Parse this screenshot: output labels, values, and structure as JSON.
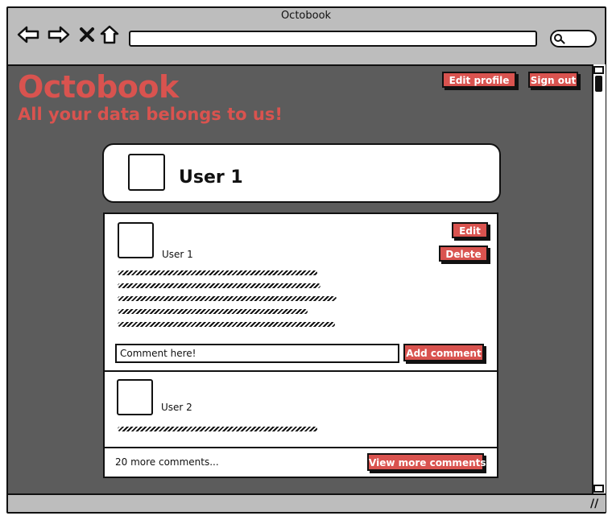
{
  "window": {
    "title": "Octobook"
  },
  "toolbar": {
    "back_icon": "arrow-left-outline-icon",
    "forward_icon": "arrow-right-outline-icon",
    "stop_icon": "close-x-icon",
    "home_icon": "home-outline-icon",
    "url_value": "",
    "search_icon": "search-icon"
  },
  "page": {
    "brand": "Octobook",
    "tagline": "All your data belongs to us!",
    "accent_color": "#d9534f",
    "background_color": "#5c5c5c"
  },
  "header_actions": {
    "edit_profile": "Edit profile",
    "sign_out": "Sign out"
  },
  "profile": {
    "name": "User 1"
  },
  "post": {
    "author": "User 1",
    "edit_label": "Edit",
    "delete_label": "Delete",
    "comment_placeholder": "Comment here!",
    "add_comment_label": "Add comment"
  },
  "comment": {
    "author": "User 2"
  },
  "footer": {
    "more_comments": "20 more comments...",
    "view_more_label": "View more comments"
  }
}
